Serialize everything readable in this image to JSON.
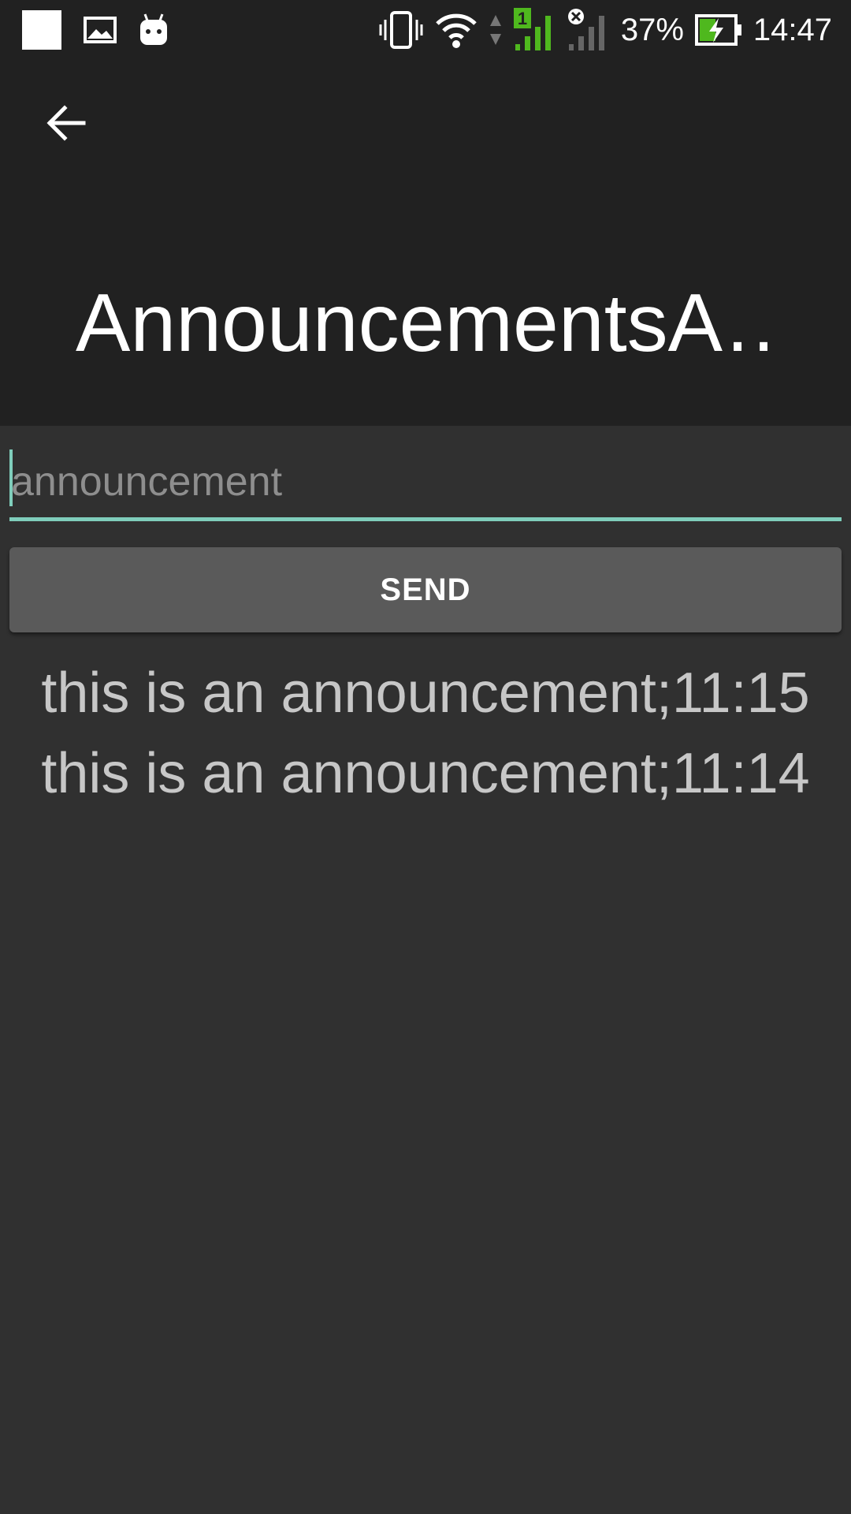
{
  "status_bar": {
    "battery_percent": "37%",
    "time": "14:47",
    "sim_number": "1",
    "icons": [
      "square-notification-icon",
      "image-icon",
      "android-icon",
      "vibrate-icon",
      "wifi-icon",
      "data-arrows-icon",
      "signal-sim1-icon",
      "signal-no-sim-icon",
      "battery-charging-icon"
    ],
    "colors": {
      "sim1_signal": "#4fb81e",
      "battery_bolt": "#4fb81e"
    }
  },
  "app_bar": {
    "title": "AnnouncementsA…",
    "back_icon": "arrow-back-icon"
  },
  "form": {
    "input_placeholder": "announcement",
    "input_value": "",
    "send_label": "SEND",
    "accent_color": "#7fcdbb"
  },
  "announcements": [
    "this is an announcement;11:15",
    "this is an announcement;11:14"
  ]
}
